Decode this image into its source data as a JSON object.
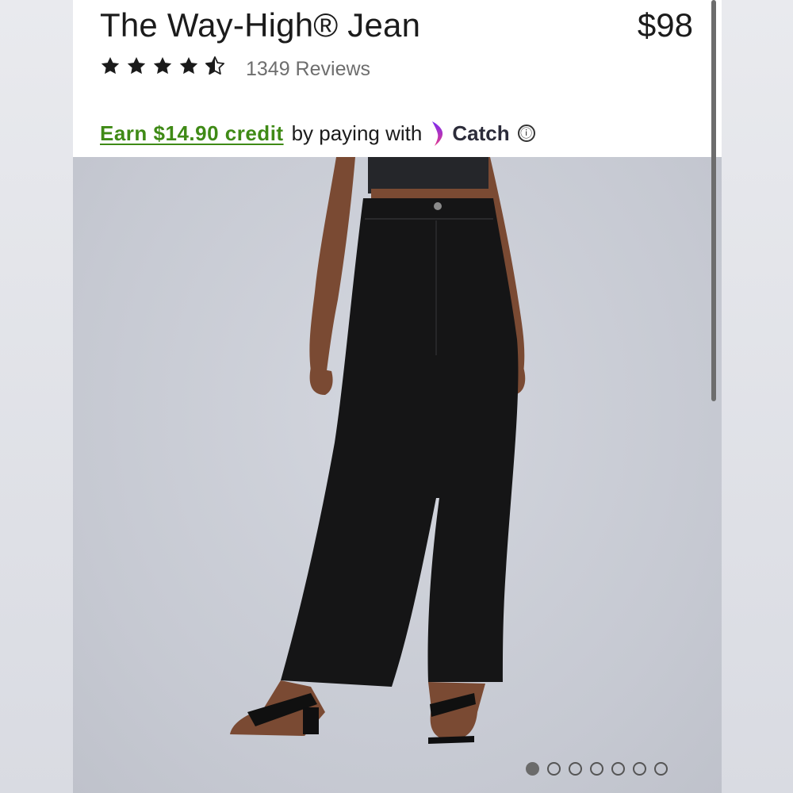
{
  "product": {
    "title": "The Way-High® Jean",
    "price": "$98",
    "rating": 4.5,
    "rating_max": 5,
    "reviews_label": "1349 Reviews"
  },
  "credit": {
    "link_text": "Earn $14.90 credit",
    "by_text": "by paying with",
    "brand": "Catch",
    "info_icon": "ⓘ"
  },
  "carousel": {
    "total": 7,
    "active_index": 0
  },
  "colors": {
    "credit_link": "#3f8a16",
    "catch_logo_purple": "#7b2cf0",
    "catch_logo_pink": "#e23a8e"
  },
  "icons": [
    "star-icon",
    "star-half-icon",
    "catch-logo-icon",
    "info-icon"
  ]
}
